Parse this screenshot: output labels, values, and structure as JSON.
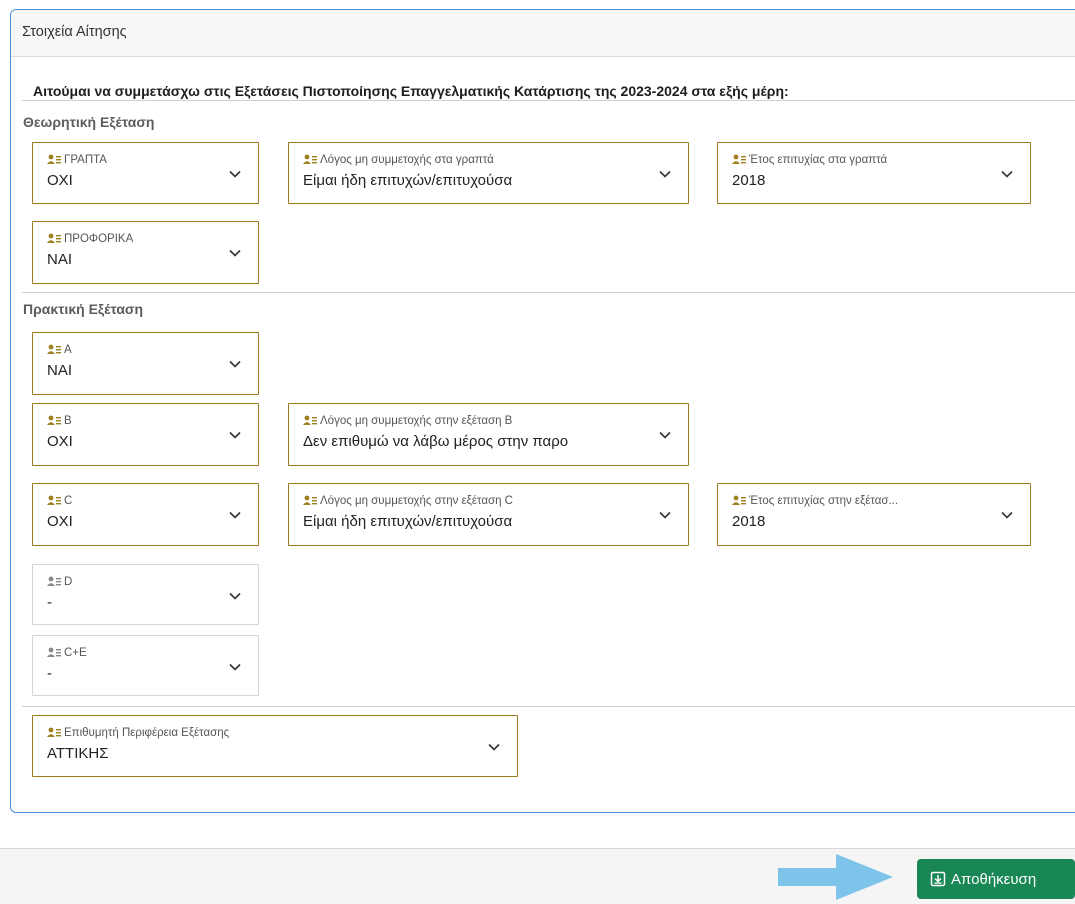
{
  "card": {
    "header": "Στοιχεία Αίτησης",
    "request_text": "Αιτούμαι να συμμετάσχω στις Εξετάσεις Πιστοποίησης Επαγγελματικής Κατάρτισης της 2023-2024 στα εξής μέρη:"
  },
  "theory": {
    "title": "Θεωρητική Εξέταση",
    "written": {
      "label": "ΓΡΑΠΤΑ",
      "value": "ΟΧΙ"
    },
    "written_reason": {
      "label": "Λόγος μη συμμετοχής στα γραπτά",
      "value": "Είμαι ήδη επιτυχών/επιτυχούσα"
    },
    "written_year": {
      "label": "Έτος επιτυχίας στα γραπτά",
      "value": "2018"
    },
    "oral": {
      "label": "ΠΡΟΦΟΡΙΚΑ",
      "value": "ΝΑΙ"
    }
  },
  "practical": {
    "title": "Πρακτική Εξέταση",
    "a": {
      "label": "A",
      "value": "ΝΑΙ"
    },
    "b": {
      "label": "B",
      "value": "ΟΧΙ"
    },
    "b_reason": {
      "label": "Λόγος μη συμμετοχής στην εξέταση B",
      "value": "Δεν επιθυμώ να λάβω μέρος στην παρο"
    },
    "c": {
      "label": "C",
      "value": "ΟΧΙ"
    },
    "c_reason": {
      "label": "Λόγος μη συμμετοχής στην εξέταση C",
      "value": "Είμαι ήδη επιτυχών/επιτυχούσα"
    },
    "c_year": {
      "label": "Έτος επιτυχίας στην εξέτασ...",
      "value": "2018"
    },
    "d": {
      "label": "D",
      "value": "-"
    },
    "ce": {
      "label": "C+E",
      "value": "-"
    }
  },
  "region": {
    "label": "Επιθυμητή Περιφέρεια Εξέτασης",
    "value": "ΑΤΤΙΚΗΣ"
  },
  "footer": {
    "save_label": "Αποθήκευση"
  },
  "colors": {
    "field_border": "#9a7a1f",
    "save_button": "#198754",
    "arrow": "#7ec3ea",
    "card_border": "#4a90d9"
  },
  "icons": {
    "field": "user-list-icon",
    "dropdown": "chevron-down-icon",
    "save": "save-icon",
    "pointer": "arrow-right-icon"
  }
}
